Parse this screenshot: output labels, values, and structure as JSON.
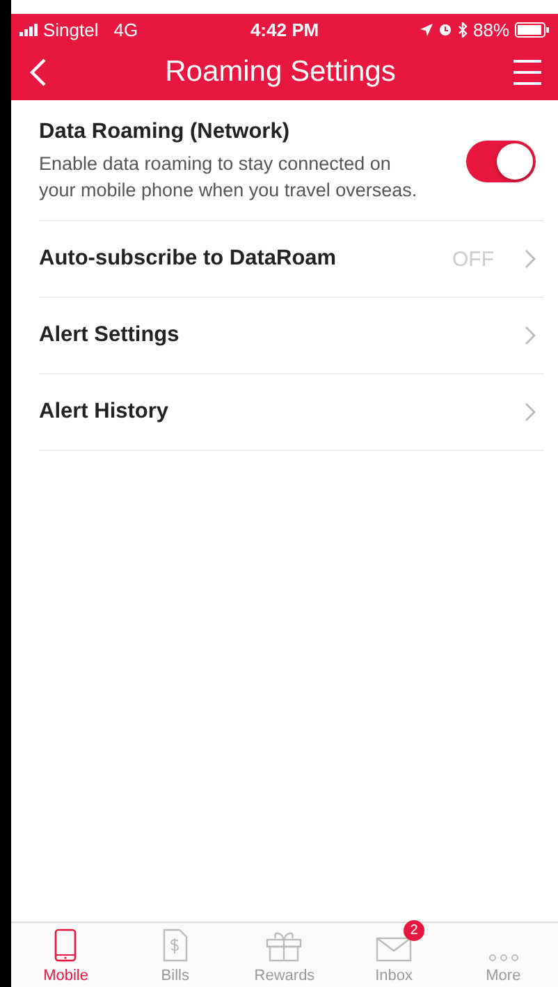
{
  "status_bar": {
    "carrier": "Singtel",
    "network": "4G",
    "time": "4:42 PM",
    "battery": "88%"
  },
  "header": {
    "title": "Roaming Settings"
  },
  "settings": [
    {
      "kind": "toggle",
      "label": "Data Roaming (Network)",
      "description": "Enable data roaming to stay connected on your mobile phone when you travel overseas.",
      "on": true
    },
    {
      "kind": "link",
      "label": "Auto-subscribe to DataRoam",
      "value": "OFF"
    },
    {
      "kind": "link",
      "label": "Alert Settings"
    },
    {
      "kind": "link",
      "label": "Alert History"
    }
  ],
  "tab_bar": [
    {
      "label": "Mobile",
      "kind": "phone",
      "selected": true
    },
    {
      "label": "Bills",
      "kind": "bill",
      "selected": false
    },
    {
      "label": "Rewards",
      "kind": "gift",
      "selected": false
    },
    {
      "label": "Inbox",
      "kind": "mail",
      "selected": false,
      "badge": "2"
    },
    {
      "label": "More",
      "kind": "dots",
      "selected": false
    }
  ]
}
